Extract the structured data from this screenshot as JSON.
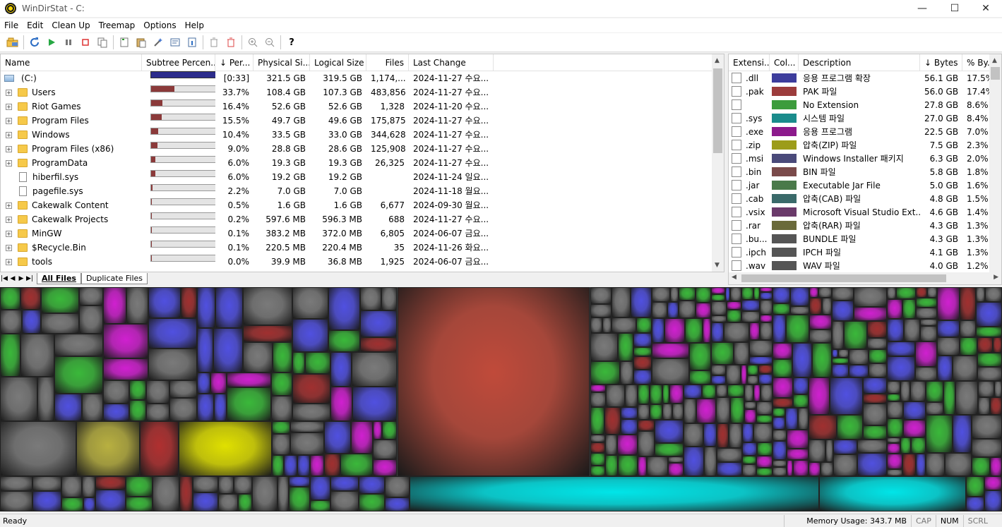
{
  "window": {
    "title": "WinDirStat - C:",
    "minimize": "—",
    "maximize": "☐",
    "close": "✕"
  },
  "menu": [
    "File",
    "Edit",
    "Clean Up",
    "Treemap",
    "Options",
    "Help"
  ],
  "toolbar": {
    "icons": [
      "open-drive-icon",
      "refresh-icon",
      "play-icon",
      "pause-icon",
      "stop-icon",
      "copy-path-icon",
      "new-file-icon",
      "paste-icon",
      "wand-icon",
      "properties-icon",
      "info-icon",
      "delete-icon",
      "delete-permanent-icon",
      "zoom-in-icon",
      "zoom-out-icon",
      "help-icon"
    ],
    "help_label": "?"
  },
  "tree": {
    "columns": [
      "Name",
      "Subtree Percen...",
      "↓ Per...",
      "Physical Si...",
      "Logical Size",
      "Files",
      "Last Change"
    ],
    "rows": [
      {
        "name": "(C:)",
        "kind": "drive",
        "percent_fraction": 1.0,
        "per": "[0:33]",
        "physical": "321.5 GB",
        "logical": "319.5 GB",
        "files": "1,174,...",
        "last_change": "2024-11-27 수요..."
      },
      {
        "name": "Users",
        "kind": "folder",
        "percent_fraction": 0.337,
        "per": "33.7%",
        "physical": "108.4 GB",
        "logical": "107.3 GB",
        "files": "483,856",
        "last_change": "2024-11-27 수요..."
      },
      {
        "name": "Riot Games",
        "kind": "folder",
        "percent_fraction": 0.164,
        "per": "16.4%",
        "physical": "52.6 GB",
        "logical": "52.6 GB",
        "files": "1,328",
        "last_change": "2024-11-20 수요..."
      },
      {
        "name": "Program Files",
        "kind": "folder",
        "percent_fraction": 0.155,
        "per": "15.5%",
        "physical": "49.7 GB",
        "logical": "49.6 GB",
        "files": "175,875",
        "last_change": "2024-11-27 수요..."
      },
      {
        "name": "Windows",
        "kind": "folder",
        "percent_fraction": 0.104,
        "per": "10.4%",
        "physical": "33.5 GB",
        "logical": "33.0 GB",
        "files": "344,628",
        "last_change": "2024-11-27 수요..."
      },
      {
        "name": "Program Files (x86)",
        "kind": "folder",
        "percent_fraction": 0.09,
        "per": "9.0%",
        "physical": "28.8 GB",
        "logical": "28.6 GB",
        "files": "125,908",
        "last_change": "2024-11-27 수요..."
      },
      {
        "name": "ProgramData",
        "kind": "folder",
        "percent_fraction": 0.06,
        "per": "6.0%",
        "physical": "19.3 GB",
        "logical": "19.3 GB",
        "files": "26,325",
        "last_change": "2024-11-27 수요..."
      },
      {
        "name": "hiberfil.sys",
        "kind": "file",
        "percent_fraction": 0.06,
        "per": "6.0%",
        "physical": "19.2 GB",
        "logical": "19.2 GB",
        "files": "",
        "last_change": "2024-11-24 일요..."
      },
      {
        "name": "pagefile.sys",
        "kind": "file",
        "percent_fraction": 0.022,
        "per": "2.2%",
        "physical": "7.0 GB",
        "logical": "7.0 GB",
        "files": "",
        "last_change": "2024-11-18 월요..."
      },
      {
        "name": "Cakewalk Content",
        "kind": "folder",
        "percent_fraction": 0.005,
        "per": "0.5%",
        "physical": "1.6 GB",
        "logical": "1.6 GB",
        "files": "6,677",
        "last_change": "2024-09-30 월요..."
      },
      {
        "name": "Cakewalk Projects",
        "kind": "folder",
        "percent_fraction": 0.002,
        "per": "0.2%",
        "physical": "597.6 MB",
        "logical": "596.3 MB",
        "files": "688",
        "last_change": "2024-11-27 수요..."
      },
      {
        "name": "MinGW",
        "kind": "folder",
        "percent_fraction": 0.001,
        "per": "0.1%",
        "physical": "383.2 MB",
        "logical": "372.0 MB",
        "files": "6,805",
        "last_change": "2024-06-07 금요..."
      },
      {
        "name": "$Recycle.Bin",
        "kind": "folder",
        "percent_fraction": 0.001,
        "per": "0.1%",
        "physical": "220.5 MB",
        "logical": "220.4 MB",
        "files": "35",
        "last_change": "2024-11-26 화요..."
      },
      {
        "name": "tools",
        "kind": "folder",
        "percent_fraction": 0.0,
        "per": "0.0%",
        "physical": "39.9 MB",
        "logical": "36.8 MB",
        "files": "1,925",
        "last_change": "2024-06-07 금요..."
      }
    ]
  },
  "tabs": {
    "all_files": "All Files",
    "duplicate_files": "Duplicate Files"
  },
  "extensions": {
    "columns": [
      "Extensi...",
      "Col...",
      "Description",
      "↓ Bytes",
      "% By..."
    ],
    "rows": [
      {
        "ext": ".dll",
        "color": "#3c3c9c",
        "desc": "응용 프로그램 확장",
        "bytes": "56.1 GB",
        "pct": "17.5%"
      },
      {
        "ext": ".pak",
        "color": "#9c3c3c",
        "desc": "PAK 파일",
        "bytes": "56.0 GB",
        "pct": "17.4%"
      },
      {
        "ext": "",
        "color": "#3c9c3c",
        "desc": "No Extension",
        "bytes": "27.8 GB",
        "pct": "8.6%"
      },
      {
        "ext": ".sys",
        "color": "#1a8c8c",
        "desc": "시스템 파일",
        "bytes": "27.0 GB",
        "pct": "8.4%"
      },
      {
        "ext": ".exe",
        "color": "#8c1a8c",
        "desc": "응용 프로그램",
        "bytes": "22.5 GB",
        "pct": "7.0%"
      },
      {
        "ext": ".zip",
        "color": "#9c9c1a",
        "desc": "압축(ZIP) 파일",
        "bytes": "7.5 GB",
        "pct": "2.3%"
      },
      {
        "ext": ".msi",
        "color": "#4a4a7a",
        "desc": "Windows Installer 패키지",
        "bytes": "6.3 GB",
        "pct": "2.0%"
      },
      {
        "ext": ".bin",
        "color": "#7a4a4a",
        "desc": "BIN 파일",
        "bytes": "5.8 GB",
        "pct": "1.8%"
      },
      {
        "ext": ".jar",
        "color": "#4a7a4a",
        "desc": "Executable Jar File",
        "bytes": "5.0 GB",
        "pct": "1.6%"
      },
      {
        "ext": ".cab",
        "color": "#3a6a6a",
        "desc": "압축(CAB) 파일",
        "bytes": "4.8 GB",
        "pct": "1.5%"
      },
      {
        "ext": ".vsix",
        "color": "#6a3a6a",
        "desc": "Microsoft Visual Studio Ext...",
        "bytes": "4.6 GB",
        "pct": "1.4%"
      },
      {
        "ext": ".rar",
        "color": "#6a6a3a",
        "desc": "압축(RAR) 파일",
        "bytes": "4.3 GB",
        "pct": "1.3%"
      },
      {
        "ext": ".bu...",
        "color": "#555555",
        "desc": "BUNDLE 파일",
        "bytes": "4.3 GB",
        "pct": "1.3%"
      },
      {
        "ext": ".ipch",
        "color": "#555555",
        "desc": "IPCH 파일",
        "bytes": "4.1 GB",
        "pct": "1.3%"
      },
      {
        "ext": ".wav",
        "color": "#555555",
        "desc": "WAV 파일",
        "bytes": "4.0 GB",
        "pct": "1.2%"
      }
    ]
  },
  "status": {
    "left": "Ready",
    "memory": "Memory Usage: 343.7 MB",
    "cap": "CAP",
    "num": "NUM",
    "scrl": "SCRL"
  },
  "colors": {
    "red_block": "#c04a3a",
    "cyan_block": "#00e5e8",
    "green": "#3ab83a",
    "blue": "#5050e0",
    "magenta": "#d020d0",
    "yellow": "#e0e000",
    "gray": "#7a7a7a"
  }
}
